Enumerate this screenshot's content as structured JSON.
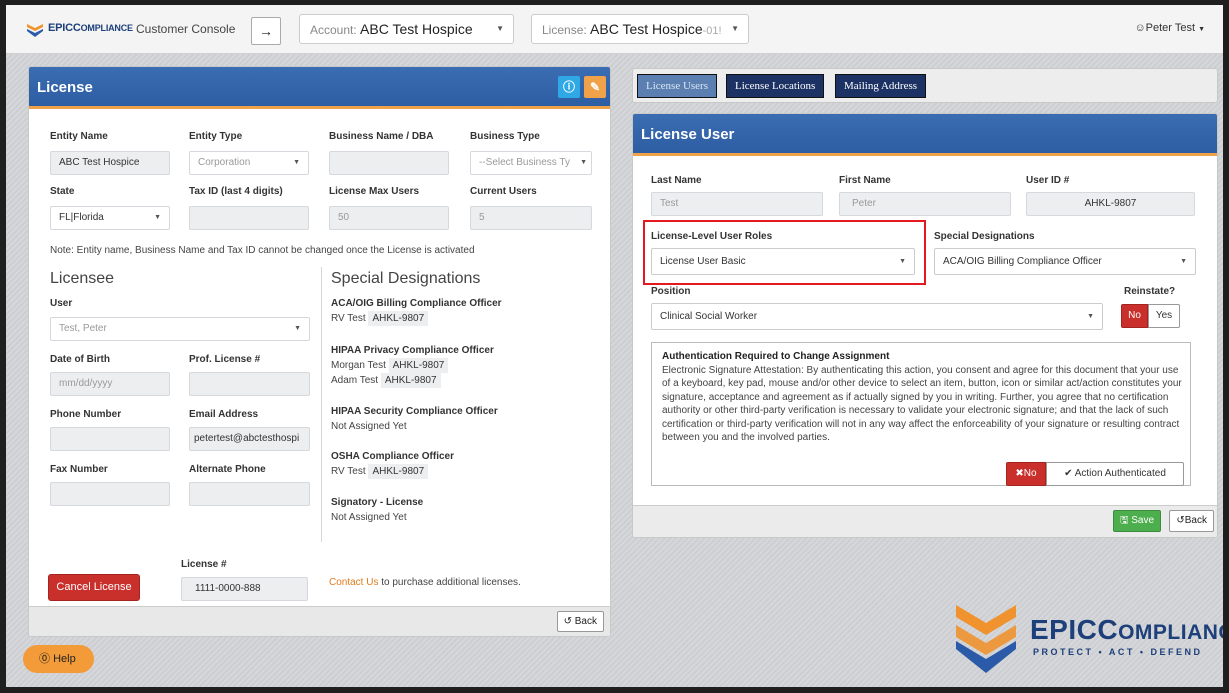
{
  "topbar": {
    "brand_main": "EPIC",
    "brand_sc": "OMPLIANCE",
    "console_title": "Customer Console",
    "account_prefix": "Account:",
    "account_value": "ABC Test Hospice",
    "license_prefix": "License:",
    "license_value": "ABC Test Hospice",
    "license_suffix": "-01!",
    "user_name": "Peter Test"
  },
  "license_panel": {
    "title": "License",
    "labels": {
      "entity_name": "Entity Name",
      "entity_type": "Entity Type",
      "business_name": "Business Name / DBA",
      "business_type": "Business Type",
      "state": "State",
      "tax_id": "Tax ID (last 4 digits)",
      "license_max_users": "License Max Users",
      "current_users": "Current Users"
    },
    "values": {
      "entity_name": "ABC Test Hospice",
      "entity_type": "Corporation",
      "business_name": "",
      "business_type_placeholder": "--Select Business Ty",
      "state": "FL|Florida",
      "tax_id": "",
      "license_max_users": "50",
      "current_users": "5"
    },
    "note": "Note: Entity name, Business Name and Tax ID cannot be changed once the License is activated",
    "licensee": {
      "title": "Licensee",
      "user_label": "User",
      "user_value": "Test, Peter",
      "dob_label": "Date of Birth",
      "dob_placeholder": "mm/dd/yyyy",
      "prof_license_label": "Prof. License #",
      "phone_label": "Phone Number",
      "email_label": "Email Address",
      "email_value": "petertest@abctesthospi",
      "fax_label": "Fax Number",
      "alt_phone_label": "Alternate Phone"
    },
    "special": {
      "title": "Special Designations",
      "groups": [
        {
          "title": "ACA/OIG Billing Compliance Officer",
          "lines": [
            {
              "name": "RV Test",
              "id": "AHKL-9807"
            }
          ]
        },
        {
          "title": "HIPAA Privacy Compliance Officer",
          "lines": [
            {
              "name": "Morgan Test",
              "id": "AHKL-9807"
            },
            {
              "name": "Adam Test",
              "id": "AHKL-9807"
            }
          ]
        },
        {
          "title": "HIPAA Security Compliance Officer",
          "lines": [
            {
              "name": "Not Assigned Yet",
              "id": ""
            }
          ]
        },
        {
          "title": "OSHA Compliance Officer",
          "lines": [
            {
              "name": "RV Test",
              "id": "AHKL-9807"
            }
          ]
        },
        {
          "title": "Signatory - License",
          "lines": [
            {
              "name": "Not Assigned Yet",
              "id": ""
            }
          ]
        }
      ]
    },
    "license_number_label": "License #",
    "license_number": "1111-0000-888",
    "cancel_label": "Cancel License",
    "contact_link": "Contact Us",
    "contact_rest": "to purchase additional licenses.",
    "back_label": "Back"
  },
  "tabs": [
    {
      "label": "License Users",
      "active": true
    },
    {
      "label": "License Locations",
      "active": false
    },
    {
      "label": "Mailing Address",
      "active": false
    }
  ],
  "user_panel": {
    "title": "License User",
    "last_name_label": "Last Name",
    "last_name": "Test",
    "first_name_label": "First Name",
    "first_name": "Peter",
    "user_id_label": "User ID #",
    "user_id": "AHKL-9807",
    "roles_label": "License-Level User Roles",
    "roles_value": "License User Basic",
    "special_label": "Special Designations",
    "special_value": "ACA/OIG Billing Compliance Officer",
    "position_label": "Position",
    "position_value": "Clinical Social Worker",
    "reinstate_label": "Reinstate?",
    "reinstate_no": "No",
    "reinstate_yes": "Yes",
    "auth_title": "Authentication Required to Change Assignment",
    "auth_text": "Electronic Signature Attestation: By authenticating this action, you consent and agree for this document that your use of a keyboard, key pad, mouse and/or other device to select an item, button, icon or similar act/action constitutes your signature, acceptance and agreement as if actually signed by you in writing. Further, you agree that no certification authority or other third-party verification is necessary to validate your electronic signature; and that the lack of such certification or third-party verification will not in any way affect the enforceability of your signature or resulting contract between you and the involved parties.",
    "auth_no": "No",
    "auth_yes": "Action Authenticated",
    "save_label": "Save",
    "back_label": "Back"
  },
  "help_label": "Help",
  "footer_brand": {
    "main": "EPIC",
    "sc": "OMPLIANCE",
    "tagline": "PROTECT • ACT • DEFEND"
  },
  "colors": {
    "header_blue": "#2d5da3",
    "accent_orange": "#f0a24a",
    "danger_red": "#c9302c",
    "success_green": "#4cae4c",
    "brand_navy": "#1d3f7a"
  }
}
